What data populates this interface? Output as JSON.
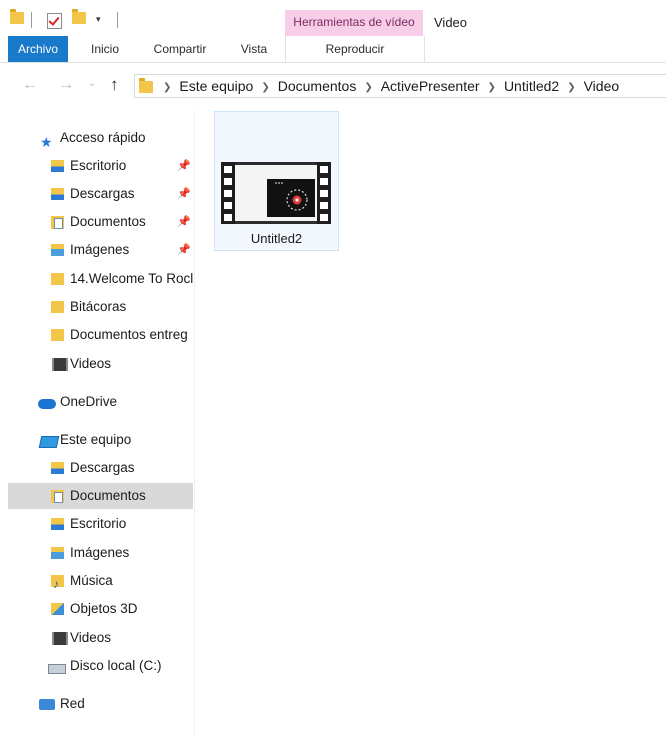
{
  "ribbon": {
    "context_group": "Herramientas de vídeo",
    "window_title": "Video",
    "tabs": {
      "archivo": "Archivo",
      "inicio": "Inicio",
      "compartir": "Compartir",
      "vista": "Vista",
      "reproducir": "Reproducir"
    },
    "colors": {
      "file_tab": "#1979ca",
      "context_band": "#f7cde8"
    }
  },
  "address_bar": {
    "breadcrumb": [
      "Este equipo",
      "Documentos",
      "ActivePresenter",
      "Untitled2",
      "Video"
    ]
  },
  "navigation": {
    "quick_access": {
      "label": "Acceso rápido",
      "items": [
        {
          "label": "Escritorio",
          "icon": "desktop-folder-icon",
          "pinned": true
        },
        {
          "label": "Descargas",
          "icon": "downloads-folder-icon",
          "pinned": true
        },
        {
          "label": "Documentos",
          "icon": "documents-folder-icon",
          "pinned": true
        },
        {
          "label": "Imágenes",
          "icon": "pictures-folder-icon",
          "pinned": true
        },
        {
          "label": "14.Welcome To Rocl",
          "icon": "folder-icon",
          "pinned": false
        },
        {
          "label": "Bitácoras",
          "icon": "folder-icon",
          "pinned": false
        },
        {
          "label": "Documentos entreg",
          "icon": "folder-icon",
          "pinned": false
        },
        {
          "label": "Videos",
          "icon": "videos-folder-icon",
          "pinned": false
        }
      ]
    },
    "onedrive": {
      "label": "OneDrive"
    },
    "this_pc": {
      "label": "Este equipo",
      "items": [
        {
          "label": "Descargas",
          "icon": "downloads-folder-icon"
        },
        {
          "label": "Documentos",
          "icon": "documents-folder-icon",
          "selected": true
        },
        {
          "label": "Escritorio",
          "icon": "desktop-folder-icon"
        },
        {
          "label": "Imágenes",
          "icon": "pictures-folder-icon"
        },
        {
          "label": "Música",
          "icon": "music-folder-icon"
        },
        {
          "label": "Objetos 3D",
          "icon": "3d-objects-folder-icon"
        },
        {
          "label": "Videos",
          "icon": "videos-folder-icon"
        },
        {
          "label": "Disco local (C:)",
          "icon": "local-disk-icon"
        }
      ]
    },
    "network": {
      "label": "Red"
    }
  },
  "content": {
    "items": [
      {
        "name": "Untitled2",
        "icon": "video-file-thumbnail-icon",
        "selected": true
      }
    ]
  }
}
